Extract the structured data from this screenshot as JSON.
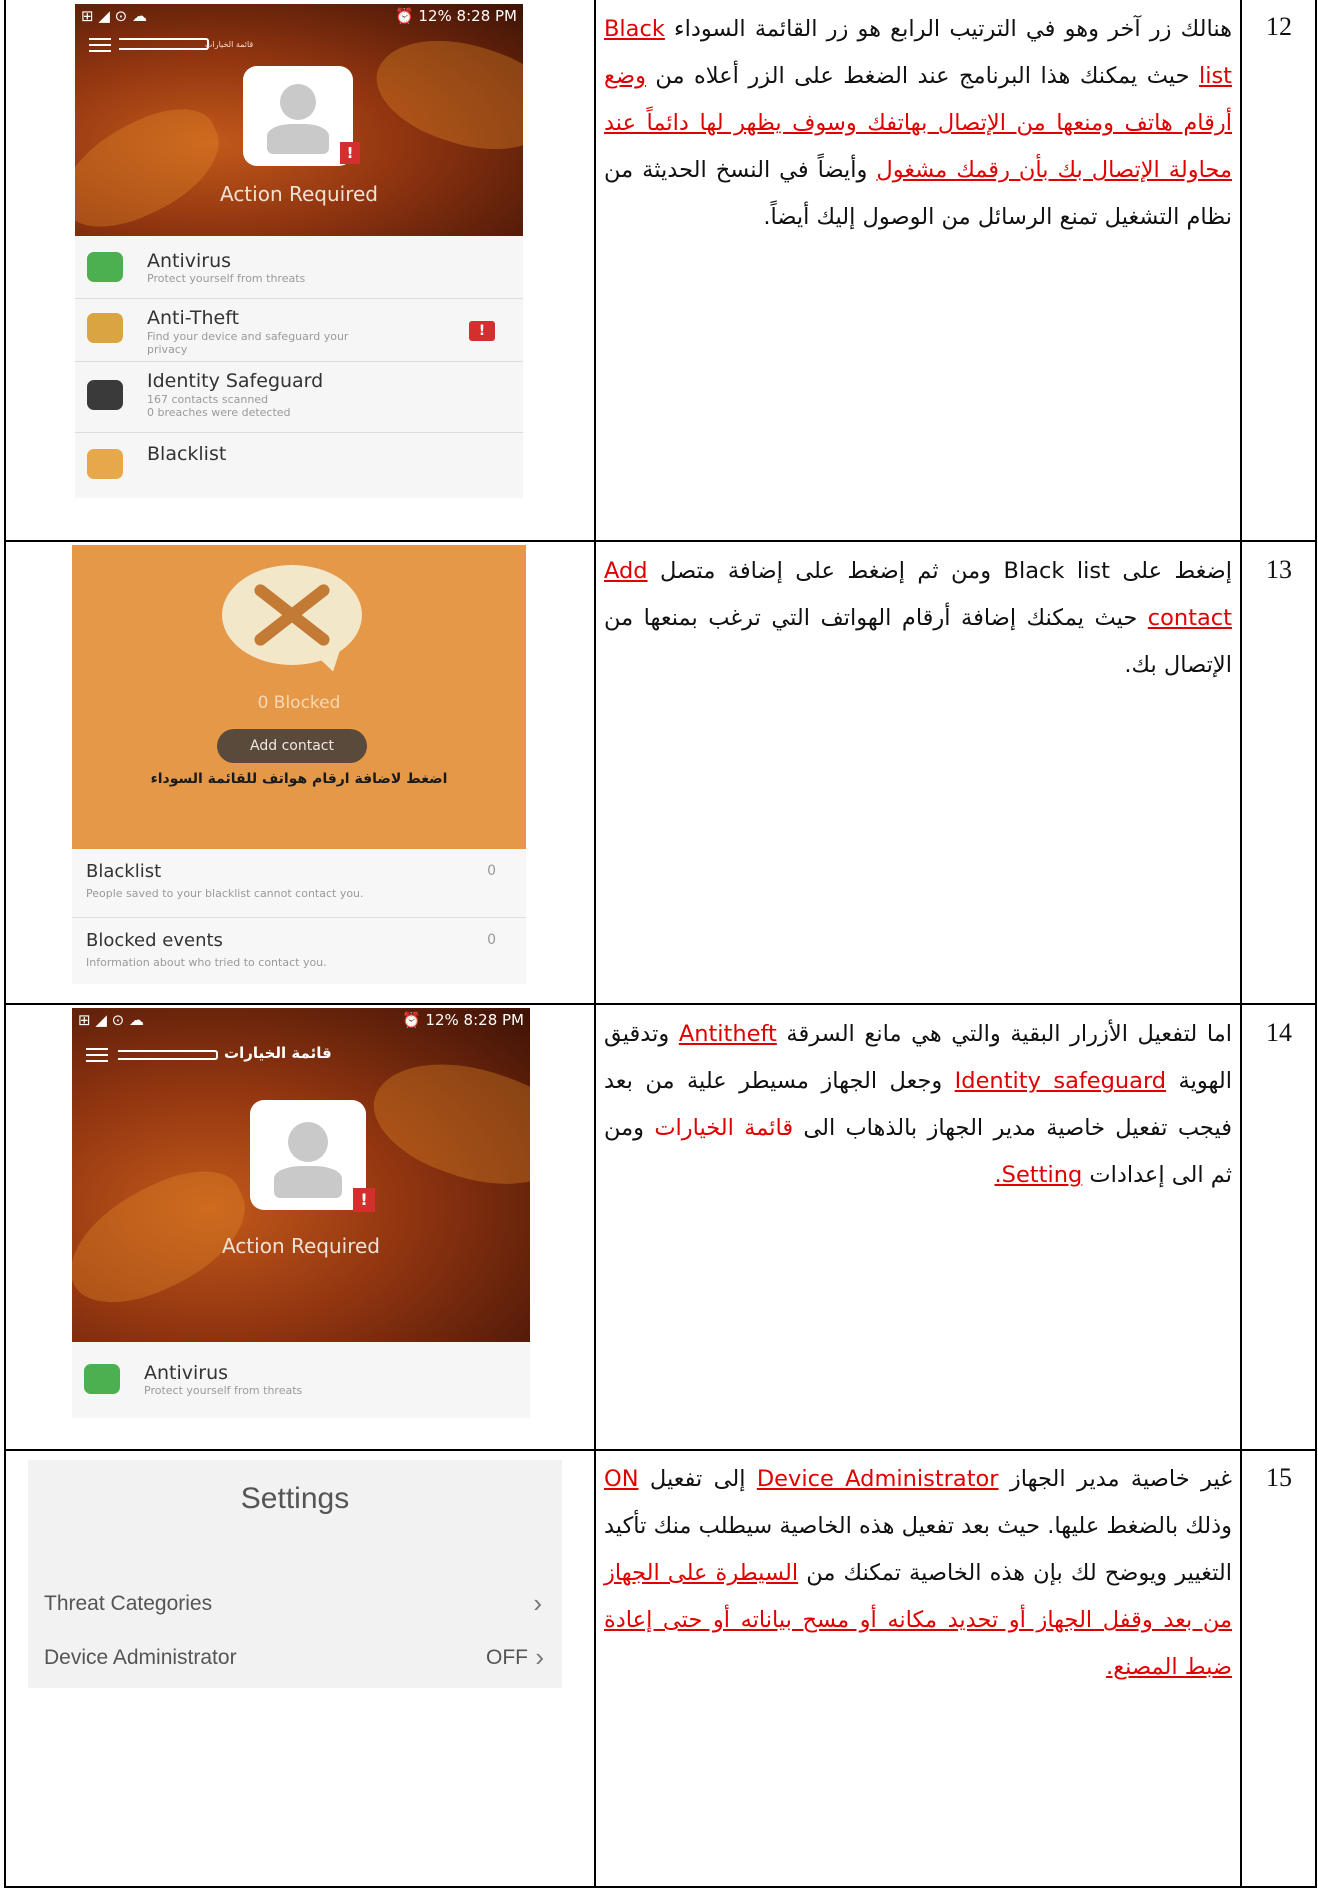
{
  "rows": [
    {
      "number": "12",
      "paragraph_parts": [
        {
          "text": "هنالك زر آخر وهو في الترتيب الرابع هو زر القائمة السوداء ",
          "style": "plain"
        },
        {
          "text": "Black list",
          "style": "link"
        },
        {
          "text": " حيث يمكنك هذا البرنامج عند الضغط على الزر أعلاه من ",
          "style": "plain"
        },
        {
          "text": "وضع أرقام هاتف ومنعها من الإتصال بهاتفك وسوف يظهر لها دائماً عند محاولة الإتصال بك بأن رقمك مشغول",
          "style": "link"
        },
        {
          "text": " وأيضاً في النسخ الحديثة من نظام التشغيل تمنع الرسائل من الوصول إليك أيضاً.",
          "style": "plain"
        }
      ],
      "screenshot": {
        "status_time": "8:28 PM",
        "status_battery": "12%",
        "menu_label": "قائمة الخيارات",
        "hero_title": "Action Required",
        "badge": "!",
        "items": [
          {
            "title": "Antivirus",
            "sub": "Protect yourself from threats",
            "icon": "shield-icon",
            "color": "#4caf50",
            "alert": false
          },
          {
            "title": "Anti-Theft",
            "sub": "Find your device and safeguard your privacy",
            "icon": "map-pin-icon",
            "color": "#d9a441",
            "alert": true
          },
          {
            "title": "Identity Safeguard",
            "sub": "167 contacts scanned\n0 breaches were detected",
            "icon": "identity-icon",
            "color": "#3a3a3a",
            "alert": false
          },
          {
            "title": "Blacklist",
            "sub": "",
            "icon": "blacklist-icon",
            "color": "#e6a84a",
            "alert": false
          }
        ]
      }
    },
    {
      "number": "13",
      "paragraph_parts": [
        {
          "text": "إضغط على Black list ومن ثم إضغط على إضافة متصل ",
          "style": "plain"
        },
        {
          "text": "Add",
          "style": "link"
        },
        {
          "text": " ",
          "style": "plain"
        },
        {
          "text": "contact",
          "style": "link"
        },
        {
          "text": " حيث يمكنك إضافة أرقام الهواتف التي ترغب بمنعها من الإتصال بك.",
          "style": "plain"
        }
      ],
      "screenshot": {
        "blocked_count": "0 Blocked",
        "add_button": "Add contact",
        "annotation": "اضغط لاضافة ارقام هواتف للقائمة السوداء",
        "list": [
          {
            "title": "Blacklist",
            "sub": "People saved to your blacklist cannot contact you.",
            "count": "0"
          },
          {
            "title": "Blocked events",
            "sub": "Information about who tried to contact you.",
            "count": "0"
          }
        ]
      }
    },
    {
      "number": "14",
      "paragraph_parts": [
        {
          "text": "اما لتفعيل الأزرار البقية والتي هي مانع السرقة ",
          "style": "plain"
        },
        {
          "text": "Antitheft",
          "style": "link"
        },
        {
          "text": " وتدقيق الهوية ",
          "style": "plain"
        },
        {
          "text": "Identity safeguard",
          "style": "link"
        },
        {
          "text": " وجعل الجهاز مسيطر علية من بعد فيجب تفعيل خاصية مدير الجهاز بالذهاب الى ",
          "style": "plain"
        },
        {
          "text": "قائمة الخيارات",
          "style": "red"
        },
        {
          "text": " ومن ثم الى إعدادات ",
          "style": "plain"
        },
        {
          "text": "Setting.",
          "style": "link"
        }
      ],
      "screenshot": {
        "status_time": "8:28 PM",
        "status_battery": "12%",
        "menu_label": "قائمة الخيارات",
        "hero_title": "Action Required",
        "badge": "!",
        "items": [
          {
            "title": "Antivirus",
            "sub": "Protect yourself from threats",
            "icon": "shield-icon",
            "color": "#4caf50",
            "alert": false
          }
        ]
      }
    },
    {
      "number": "15",
      "paragraph_parts": [
        {
          "text": "غير خاصية مدير الجهاز ",
          "style": "plain"
        },
        {
          "text": "Device Administrator",
          "style": "link"
        },
        {
          "text": " إلى تفعيل ",
          "style": "plain"
        },
        {
          "text": "ON",
          "style": "link"
        },
        {
          "text": " وذلك بالضغط عليها. حيث بعد تفعيل هذه الخاصية سيطلب منك تأكيد التغيير ويوضح لك بإن هذه الخاصية تمكنك من ",
          "style": "plain"
        },
        {
          "text": "السيطرة على الجهاز من بعد وقفل الجهاز أو تحديد مكانه أو مسح بياناته أو حتى إعادة ضبط المصنع.",
          "style": "link"
        }
      ],
      "screenshot": {
        "title": "Settings",
        "items": [
          {
            "label": "Threat Categories",
            "value": "",
            "chevron": "›"
          },
          {
            "label": "Device Administrator",
            "value": "OFF",
            "chevron": "›"
          }
        ]
      }
    }
  ]
}
